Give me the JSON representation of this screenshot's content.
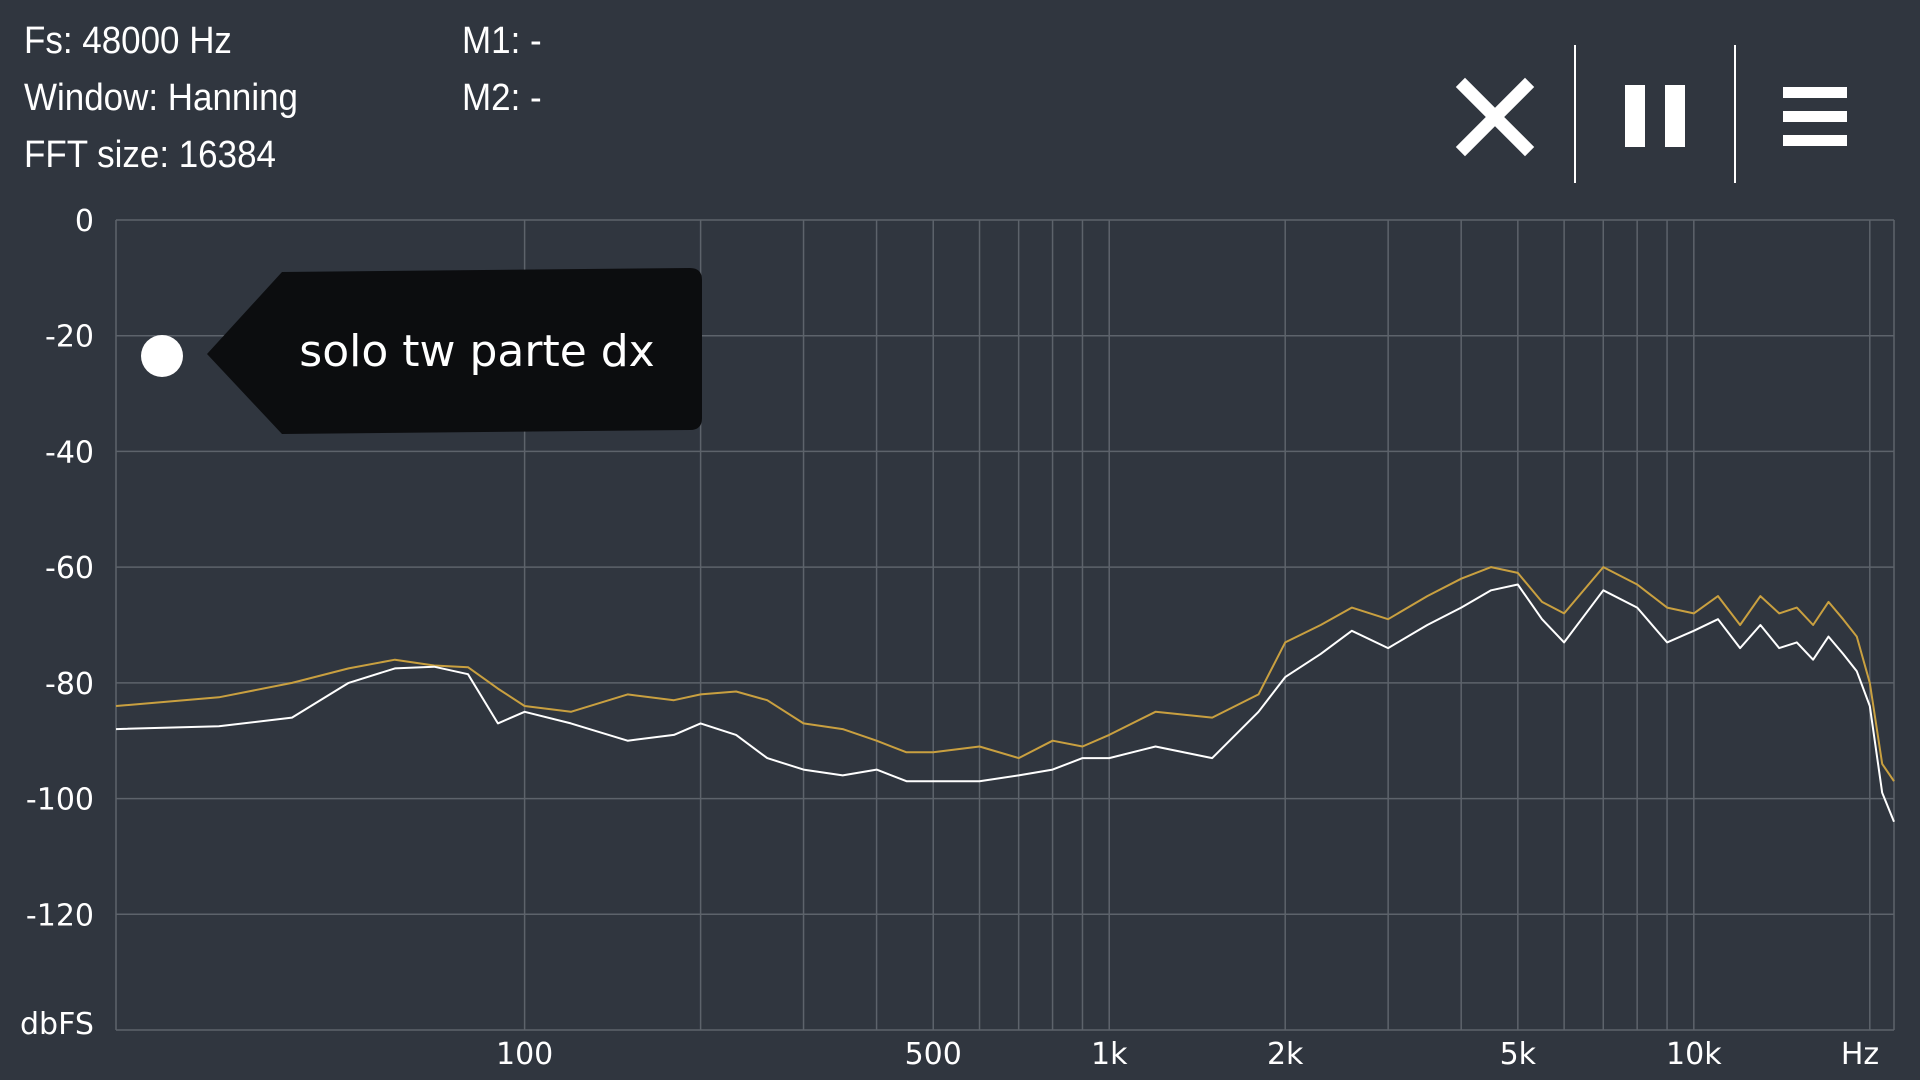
{
  "header": {
    "fs": "Fs: 48000 Hz",
    "window": "Window: Hanning",
    "fft_size": "FFT size: 16384",
    "m1": "M1: -",
    "m2": "M2: -"
  },
  "toolbar": {
    "close_icon": "close-icon",
    "pause_icon": "pause-icon",
    "menu_icon": "menu-icon"
  },
  "colors": {
    "background": "#30363f",
    "grid": "#5d636b",
    "trace_white": "#ffffff",
    "trace_gold": "#c9a040",
    "tag_bg": "#0c0d0f"
  },
  "chart_data": {
    "type": "line",
    "x_scale": "log",
    "xlabel": "Hz",
    "ylabel": "dbFS",
    "xlim": [
      20,
      22000
    ],
    "ylim": [
      -140,
      0
    ],
    "y_ticks": [
      0,
      -20,
      -40,
      -60,
      -80,
      -100,
      -120
    ],
    "y_tick_labels": [
      "0",
      "-20",
      "-40",
      "-60",
      "-80",
      "-100",
      "-120"
    ],
    "x_tick_labels": [
      {
        "value": 100,
        "label": "100"
      },
      {
        "value": 500,
        "label": "500"
      },
      {
        "value": 1000,
        "label": "1k"
      },
      {
        "value": 2000,
        "label": "2k"
      },
      {
        "value": 5000,
        "label": "5k"
      },
      {
        "value": 10000,
        "label": "10k"
      }
    ],
    "x_unit_label": "Hz",
    "grid": true,
    "x_gridlines": [
      100,
      200,
      300,
      400,
      500,
      600,
      700,
      800,
      900,
      1000,
      2000,
      3000,
      4000,
      5000,
      6000,
      7000,
      8000,
      9000,
      10000,
      20000
    ],
    "marker_label": "solo tw parte dx",
    "series": [
      {
        "color": "#c9a040",
        "x": [
          20,
          30,
          40,
          50,
          60,
          70,
          80,
          90,
          100,
          120,
          150,
          180,
          200,
          230,
          260,
          300,
          350,
          400,
          450,
          500,
          600,
          700,
          800,
          900,
          1000,
          1200,
          1500,
          1800,
          2000,
          2300,
          2600,
          3000,
          3500,
          4000,
          4500,
          5000,
          5500,
          6000,
          7000,
          8000,
          9000,
          10000,
          11000,
          12000,
          13000,
          14000,
          15000,
          16000,
          17000,
          18000,
          19000,
          20000,
          21000,
          22000
        ],
        "y": [
          -84,
          -82.5,
          -80,
          -77.5,
          -76,
          -77,
          -77.3,
          -81,
          -84,
          -85,
          -82,
          -83,
          -82,
          -81.5,
          -83,
          -87,
          -88,
          -90,
          -92,
          -92,
          -91,
          -93,
          -90,
          -91,
          -89,
          -85,
          -86,
          -82,
          -73,
          -70,
          -67,
          -69,
          -65,
          -62,
          -60,
          -61,
          -66,
          -68,
          -60,
          -63,
          -67,
          -68,
          -65,
          -70,
          -65,
          -68,
          -67,
          -70,
          -66,
          -69,
          -72,
          -80,
          -94,
          -97
        ]
      },
      {
        "color": "#ffffff",
        "x": [
          20,
          30,
          40,
          50,
          60,
          70,
          80,
          90,
          100,
          120,
          150,
          180,
          200,
          230,
          260,
          300,
          350,
          400,
          450,
          500,
          600,
          700,
          800,
          900,
          1000,
          1200,
          1500,
          1800,
          2000,
          2300,
          2600,
          3000,
          3500,
          4000,
          4500,
          5000,
          5500,
          6000,
          7000,
          8000,
          9000,
          10000,
          11000,
          12000,
          13000,
          14000,
          15000,
          16000,
          17000,
          18000,
          19000,
          20000,
          21000,
          22000
        ],
        "y": [
          -88,
          -87.5,
          -86,
          -80,
          -77.5,
          -77.2,
          -78.5,
          -87,
          -85,
          -87,
          -90,
          -89,
          -87,
          -89,
          -93,
          -95,
          -96,
          -95,
          -97,
          -97,
          -97,
          -96,
          -95,
          -93,
          -93,
          -91,
          -93,
          -85,
          -79,
          -75,
          -71,
          -74,
          -70,
          -67,
          -64,
          -63,
          -69,
          -73,
          -64,
          -67,
          -73,
          -71,
          -69,
          -74,
          -70,
          -74,
          -73,
          -76,
          -72,
          -75,
          -78,
          -84,
          -99,
          -104
        ]
      }
    ]
  }
}
